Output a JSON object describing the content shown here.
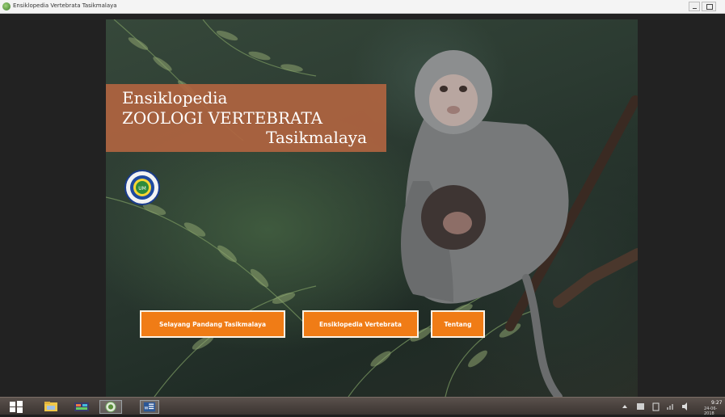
{
  "window": {
    "title": "Ensiklopedia Vertebrata Tasikmalaya"
  },
  "banner": {
    "line1": "Ensiklopedia",
    "line2": "ZOOLOGI VERTEBRATA",
    "line3": "Tasikmalaya"
  },
  "buttons": {
    "selayang": "Selayang Pandang Tasikmalaya",
    "ensiklopedia": "Ensiklopedia Vertebrata",
    "tentang": "Tentang"
  },
  "taskbar": {
    "time": "9:27",
    "date": "24-06-2018"
  },
  "icons": {
    "app": "leaf-app-icon",
    "logo": "university-seal-icon",
    "start": "windows-start-icon",
    "explorer": "file-explorer-icon",
    "media": "media-player-icon",
    "app_running": "encyclopedia-app-icon",
    "word": "word-icon"
  },
  "colors": {
    "banner": "#b06440",
    "button": "#f07c16",
    "button_border": "#fff3e6",
    "workspace": "#222222"
  }
}
